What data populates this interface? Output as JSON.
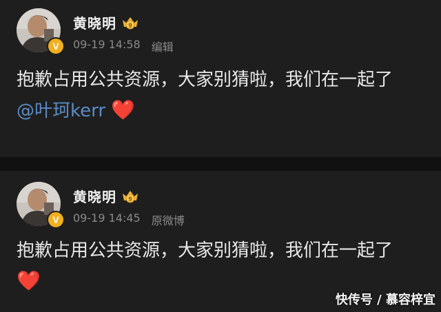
{
  "posts": [
    {
      "username": "黄晓明",
      "time": "09-19 14:58",
      "tag": "编辑",
      "text": "抱歉占用公共资源，大家别猜啦，我们在一起了",
      "mention": "@叶珂kerr",
      "heart": "❤️"
    },
    {
      "username": "黄晓明",
      "time": "09-19 14:45",
      "tag": "原微博",
      "text": "抱歉占用公共资源，大家别猜啦，我们在一起了",
      "heart": "❤️"
    }
  ],
  "watermark": "快传号 / 慕容梓宜",
  "colors": {
    "background": "#1e1e1e",
    "mention": "#5b8cc6",
    "heart": "#e0242f",
    "verified_badge": "#f2b01e"
  },
  "icons": [
    "avatar",
    "verified-icon",
    "crown-badge-icon",
    "heart-icon"
  ]
}
